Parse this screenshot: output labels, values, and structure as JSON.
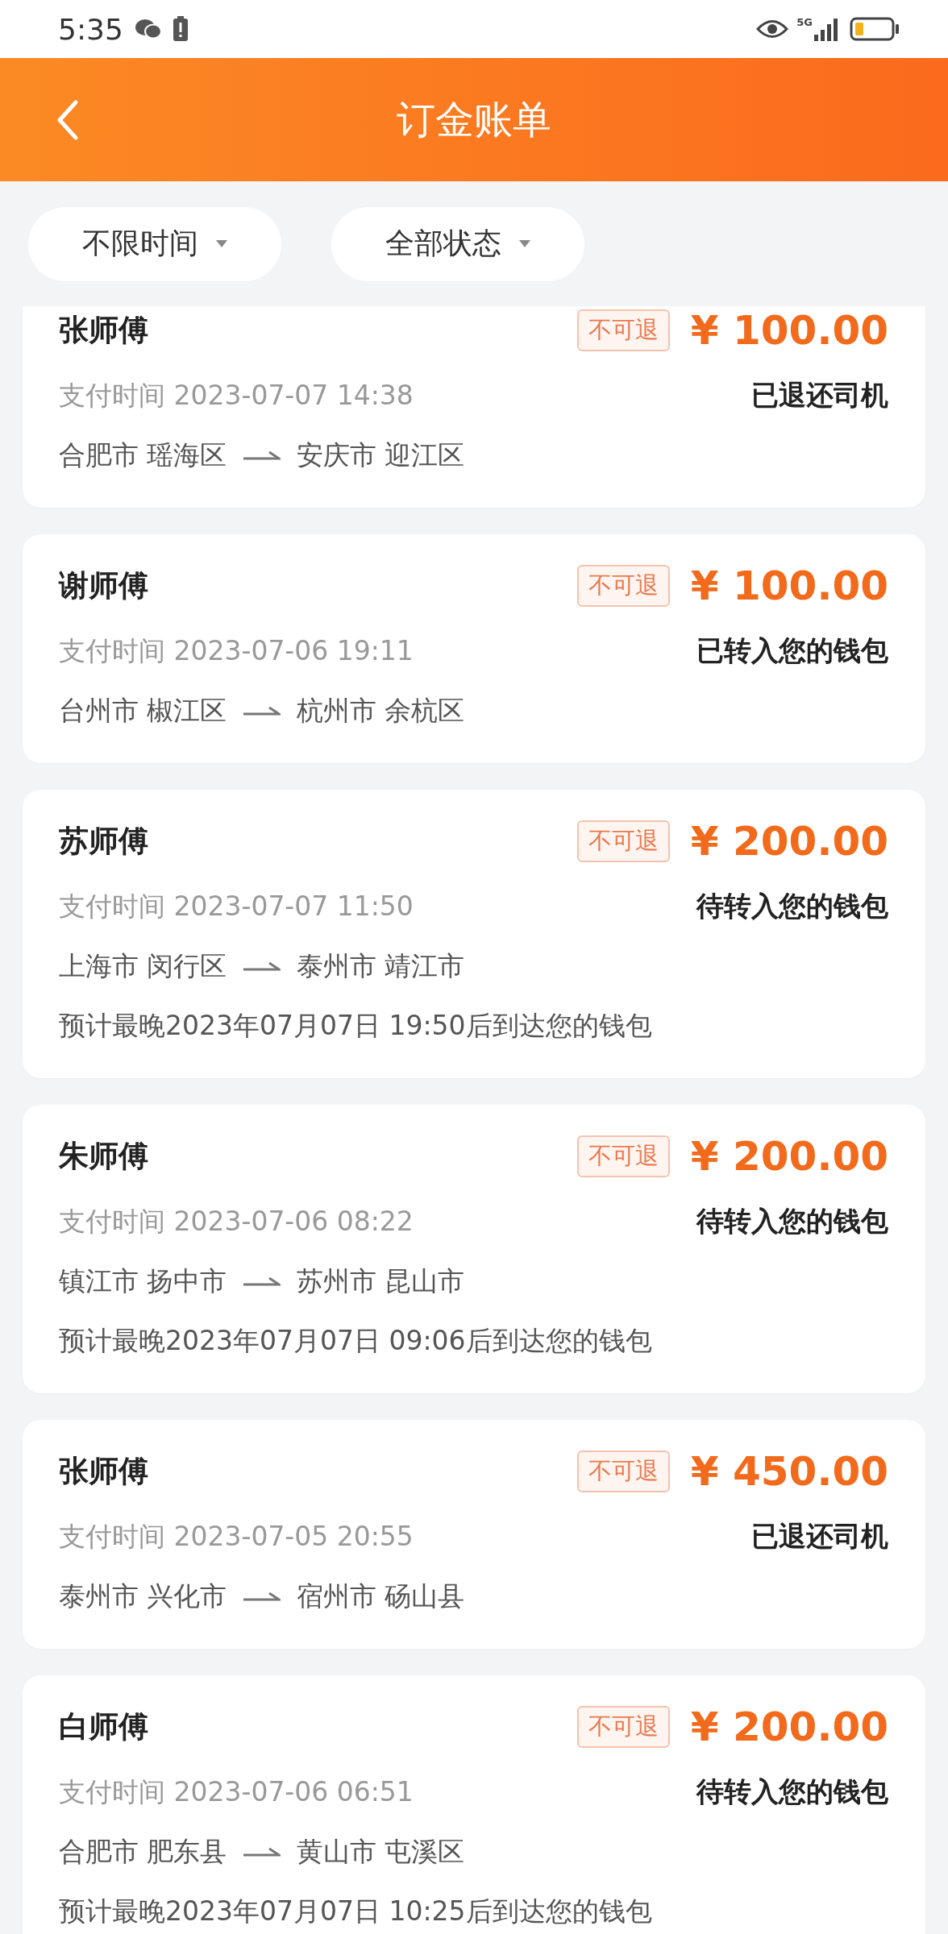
{
  "status_bar": {
    "time": "5:35",
    "network": "5G"
  },
  "header": {
    "title": "订金账单"
  },
  "filters": [
    {
      "label": "不限时间"
    },
    {
      "label": "全部状态"
    }
  ],
  "orders": [
    {
      "driver": "张师傅",
      "tag": "不可退",
      "amount": "¥ 100.00",
      "paid_at": "支付时间 2023-07-07 14:38",
      "status": "已退还司机",
      "from": "合肥市 瑶海区",
      "to": "安庆市 迎江区"
    },
    {
      "driver": "谢师傅",
      "tag": "不可退",
      "amount": "¥ 100.00",
      "paid_at": "支付时间 2023-07-06 19:11",
      "status": "已转入您的钱包",
      "from": "台州市 椒江区",
      "to": "杭州市 余杭区"
    },
    {
      "driver": "苏师傅",
      "tag": "不可退",
      "amount": "¥ 200.00",
      "paid_at": "支付时间 2023-07-07 11:50",
      "status": "待转入您的钱包",
      "from": "上海市 闵行区",
      "to": "泰州市 靖江市",
      "eta": "预计最晚2023年07月07日 19:50后到达您的钱包"
    },
    {
      "driver": "朱师傅",
      "tag": "不可退",
      "amount": "¥ 200.00",
      "paid_at": "支付时间 2023-07-06 08:22",
      "status": "待转入您的钱包",
      "from": "镇江市 扬中市",
      "to": "苏州市 昆山市",
      "eta": "预计最晚2023年07月07日 09:06后到达您的钱包"
    },
    {
      "driver": "张师傅",
      "tag": "不可退",
      "amount": "¥ 450.00",
      "paid_at": "支付时间 2023-07-05 20:55",
      "status": "已退还司机",
      "from": "泰州市 兴化市",
      "to": "宿州市 砀山县"
    },
    {
      "driver": "白师傅",
      "tag": "不可退",
      "amount": "¥ 200.00",
      "paid_at": "支付时间 2023-07-06 06:51",
      "status": "待转入您的钱包",
      "from": "合肥市 肥东县",
      "to": "黄山市 屯溪区",
      "eta": "预计最晚2023年07月07日 10:25后到达您的钱包"
    }
  ]
}
